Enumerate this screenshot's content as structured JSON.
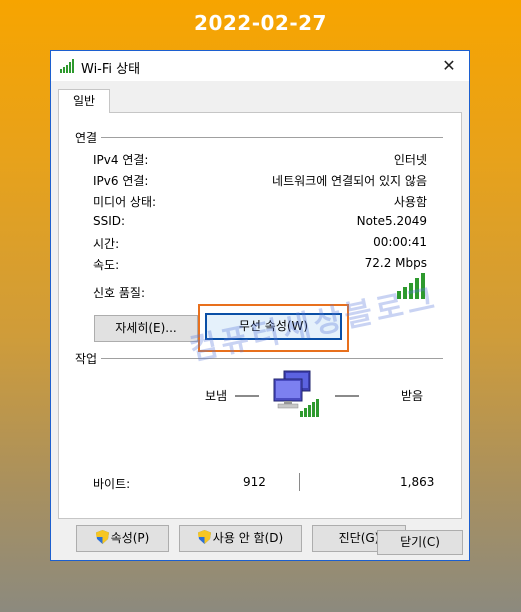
{
  "banner": {
    "date": "2022-02-27"
  },
  "window": {
    "title": "Wi-Fi 상태",
    "close_glyph": "✕",
    "icon": "wifi-signal-icon"
  },
  "tabs": [
    {
      "label": "일반"
    }
  ],
  "connection": {
    "section_label": "연결",
    "rows": [
      {
        "label": "IPv4 연결:",
        "value": "인터넷"
      },
      {
        "label": "IPv6 연결:",
        "value": "네트워크에 연결되어 있지 않음"
      },
      {
        "label": "미디어 상태:",
        "value": "사용함"
      },
      {
        "label": "SSID:",
        "value": "Note5.2049"
      },
      {
        "label": "시간:",
        "value": "00:00:41"
      },
      {
        "label": "속도:",
        "value": "72.2 Mbps"
      }
    ],
    "signal_label": "신호 품질:",
    "signal_bars_active": 5,
    "details_button": "자세히(E)...",
    "wireless_props_button": "무선 속성(W)"
  },
  "activity": {
    "section_label": "작업",
    "sent_label": "보냄",
    "received_label": "받음",
    "bytes_label": "바이트:",
    "bytes_sent": "912",
    "bytes_received": "1,863"
  },
  "buttons": {
    "properties": "속성(P)",
    "disable": "사용 안 함(D)",
    "diagnose": "진단(G)",
    "close": "닫기(C)"
  },
  "watermark": "컴퓨터세상블로그",
  "colors": {
    "highlight": "#e8701d",
    "signal": "#2e9a2e",
    "title_border": "#1c5fcf"
  }
}
